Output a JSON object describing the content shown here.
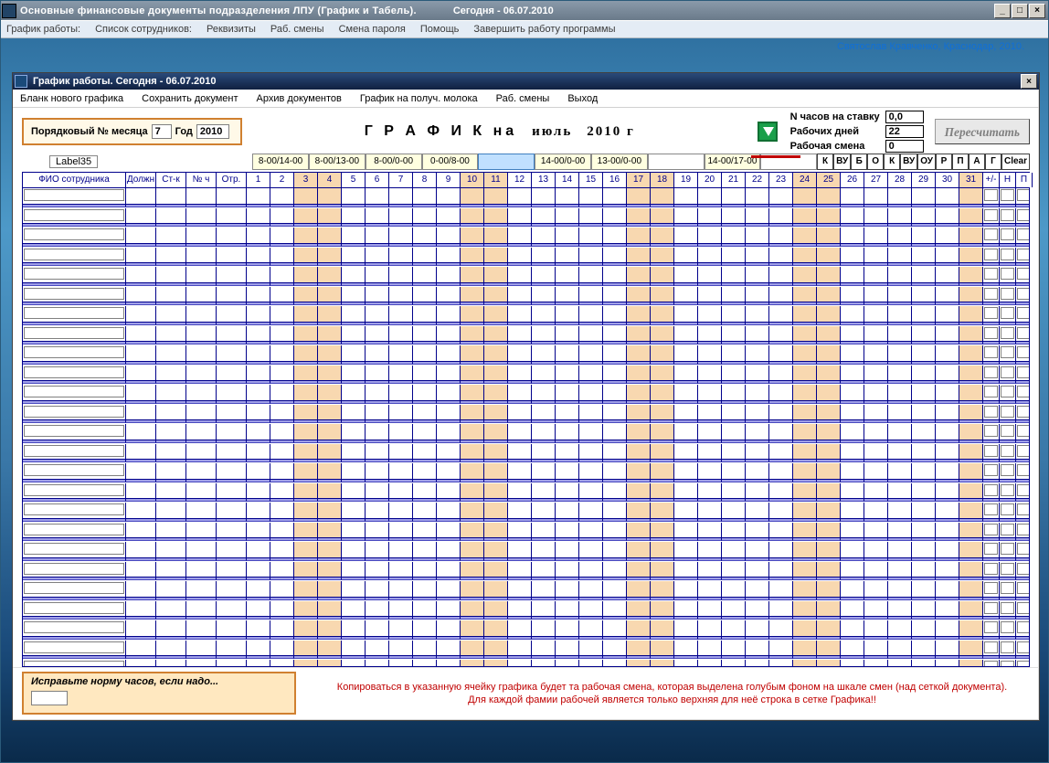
{
  "outer": {
    "title": "Основные финансовые документы подразделения  ЛПУ  (График и Табель).",
    "title_date": "Сегодня - 06.07.2010",
    "menu": [
      "График  работы:",
      "Список сотрудников:",
      "Реквизиты",
      "Раб. смены",
      "Смена пароля",
      "Помощь",
      "Завершить работу программы"
    ],
    "credit": "Святослав Кравченко, Краснодар, 2010."
  },
  "child": {
    "title": "График работы.     Сегодня - 06.07.2010",
    "menu": [
      "Бланк нового графика",
      "Сохранить документ",
      "Архив документов",
      "График на получ. молока",
      "Раб. смены",
      "Выход"
    ]
  },
  "params": {
    "month_label": "Порядковый № месяца",
    "month_value": "7",
    "year_label": "Год",
    "year_value": "2010",
    "big": "Г Р А Ф И К  на",
    "big_month": "июль",
    "big_year": "2010 г",
    "stats": {
      "l1": "N часов на ставку",
      "v1": "0,0",
      "l2": "Рабочих дней",
      "v2": "22",
      "l3": "Рабочая смена",
      "v3": "0"
    },
    "recalc": "Пересчитать",
    "label35": "Label35"
  },
  "shifts": [
    {
      "t": "8-00/14-00",
      "sel": false
    },
    {
      "t": "8-00/13-00",
      "sel": false
    },
    {
      "t": "8-00/0-00",
      "sel": false
    },
    {
      "t": "0-00/8-00",
      "sel": false
    },
    {
      "t": "",
      "sel": true,
      "empty": false
    },
    {
      "t": "14-00/0-00",
      "sel": false
    },
    {
      "t": "13-00/0-00",
      "sel": false
    },
    {
      "t": "",
      "sel": false,
      "empty": true
    },
    {
      "t": "14-00/17-00",
      "sel": false
    },
    {
      "t": "",
      "sel": false,
      "empty": true
    }
  ],
  "codes": [
    "К",
    "ВУ",
    "Б",
    "О",
    "К",
    "ВУ",
    "ОУ",
    "Р",
    "П",
    "А",
    "Г",
    "Clear"
  ],
  "headers": {
    "emp": "ФИО сотрудника",
    "small": [
      "Должн",
      "Ст-к",
      "№ ч",
      "Отр."
    ],
    "tail": [
      "+/-",
      "Н",
      "П"
    ]
  },
  "days": 31,
  "weekends": [
    3,
    4,
    10,
    11,
    17,
    18,
    24,
    25,
    31
  ],
  "rows": 28,
  "footer": {
    "fix": "Исправьте норму часов, если надо...",
    "text1": "Копироваться в указанную ячейку графика будет та рабочая смена, которая выделена  голубым фоном на шкале смен (над сеткой документа).",
    "text2": "Для каждой фамии рабочей является только верхняя для неё строка в сетке Графика!!"
  }
}
